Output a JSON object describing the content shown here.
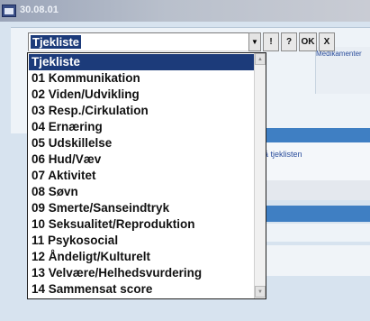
{
  "window": {
    "title": "30.08.01"
  },
  "combo": {
    "value": "Tjekliste"
  },
  "toolbar": {
    "dropdown_glyph": "▼",
    "exclaim_label": "!",
    "help_label": "?",
    "ok_label": "OK",
    "close_label": "X"
  },
  "dropdown": {
    "items": [
      "Tjekliste",
      "01 Kommunikation",
      "02 Viden/Udvikling",
      "03 Resp./Cirkulation",
      "04 Ernæring",
      "05 Udskillelse",
      "06 Hud/Væv",
      "07 Aktivitet",
      "08 Søvn",
      "09 Smerte/Sanseindtryk",
      "10 Seksualitet/Reproduktion",
      "11 Psykosocial",
      "12 Åndeligt/Kulturelt",
      "13 Velvære/Helhedsvurdering",
      "14 Sammensat score"
    ],
    "selected_index": 0,
    "scroll_up_glyph": "▲",
    "scroll_down_glyph": "▼"
  },
  "background": {
    "medikamenter": "Medikamenter",
    "tjekliste_link": "på tjeklisten"
  }
}
